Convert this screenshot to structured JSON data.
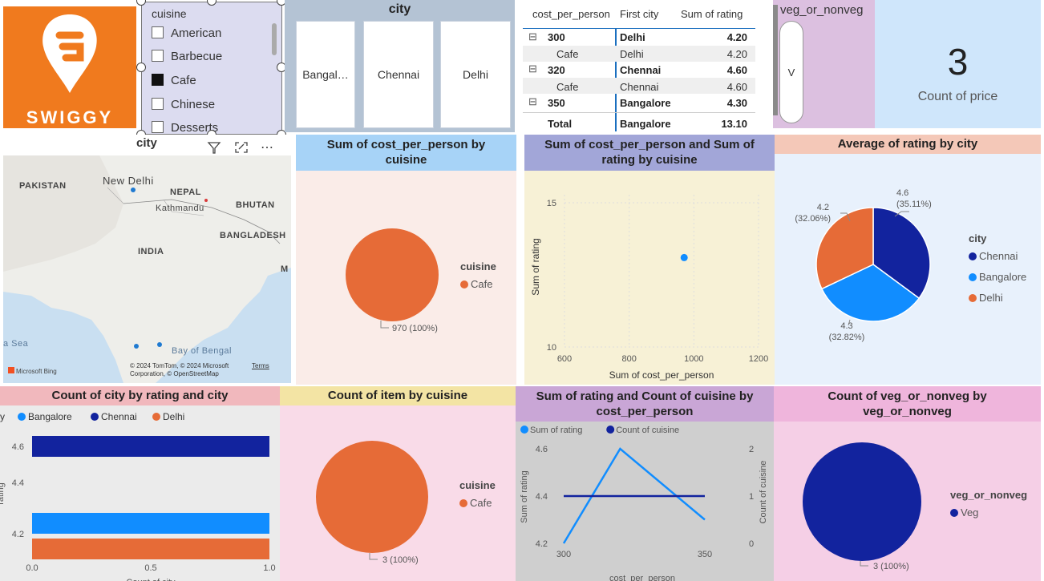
{
  "logo": {
    "text": "SWIGGY",
    "bg": "#f07a1e"
  },
  "cuisine_slicer": {
    "title": "cuisine",
    "items": [
      {
        "label": "American",
        "checked": false
      },
      {
        "label": "Barbecue",
        "checked": false
      },
      {
        "label": "Cafe",
        "checked": true
      },
      {
        "label": "Chinese",
        "checked": false
      },
      {
        "label": "Desserts",
        "checked": false
      }
    ]
  },
  "city_slicer": {
    "title": "city",
    "tiles": [
      "Bangal…",
      "Chennai",
      "Delhi"
    ]
  },
  "matrix": {
    "headers": [
      "cost_per_person",
      "First city",
      "Sum of rating"
    ],
    "rows": [
      {
        "expand": "⊟",
        "cost": "300",
        "city": "Delhi",
        "rating": "4.20",
        "bold": true
      },
      {
        "expand": "",
        "cost": "Cafe",
        "city": "Delhi",
        "rating": "4.20",
        "bold": false
      },
      {
        "expand": "⊟",
        "cost": "320",
        "city": "Chennai",
        "rating": "4.60",
        "bold": true
      },
      {
        "expand": "",
        "cost": "Cafe",
        "city": "Chennai",
        "rating": "4.60",
        "bold": false
      },
      {
        "expand": "⊟",
        "cost": "350",
        "city": "Bangalore",
        "rating": "4.30",
        "bold": true
      }
    ],
    "total": {
      "label": "Total",
      "city": "Bangalore",
      "rating": "13.10"
    }
  },
  "veg_slicer": {
    "title": "veg_or_nonveg",
    "value": "V"
  },
  "card": {
    "value": "3",
    "label": "Count of price"
  },
  "map": {
    "title": "city",
    "labels": [
      "PAKISTAN",
      "New Delhi",
      "NEPAL",
      "Kathmandu",
      "BHUTAN",
      "BANGLADESH",
      "INDIA",
      "Bay of Bengal",
      "a Sea",
      "M"
    ],
    "copyright": "© 2024 TomTom, © 2024 Microsoft Corporation, © OpenStreetMap",
    "terms": "Terms",
    "bing": "Microsoft Bing"
  },
  "colors": {
    "orange": "#e66b37",
    "navy": "#12239e",
    "blue": "#118dff",
    "slicer_bg": "#dcdcf0",
    "card_bg": "#cfe6fb"
  },
  "chart_data": [
    {
      "type": "pie",
      "title": "Sum of cost_per_person by cuisine",
      "legend_title": "cuisine",
      "slices": [
        {
          "label": "Cafe",
          "value": 970,
          "data_label": "970 (100%)",
          "color": "#e66b37"
        }
      ]
    },
    {
      "type": "scatter",
      "title": "Sum of cost_per_person and Sum of rating by cuisine",
      "xlabel": "Sum of cost_per_person",
      "ylabel": "Sum of rating",
      "xlim": [
        600,
        1200
      ],
      "ylim": [
        10,
        15
      ],
      "xticks": [
        "600",
        "800",
        "1000",
        "1200"
      ],
      "yticks": [
        "10",
        "15"
      ],
      "points": [
        {
          "x": 970,
          "y": 13.1
        }
      ]
    },
    {
      "type": "pie",
      "title": "Average of rating by city",
      "legend_title": "city",
      "slices": [
        {
          "label": "Chennai",
          "value": 4.6,
          "data_label": "4.6",
          "pct": "(35.11%)",
          "color": "#12239e"
        },
        {
          "label": "Bangalore",
          "value": 4.3,
          "data_label": "4.3",
          "pct": "(32.82%)",
          "color": "#118dff"
        },
        {
          "label": "Delhi",
          "value": 4.2,
          "data_label": "4.2",
          "pct": "(32.06%)",
          "color": "#e66b37"
        }
      ]
    },
    {
      "type": "bar",
      "title": "Count of city by rating and city",
      "legend_title": "ity",
      "legend": [
        "Bangalore",
        "Chennai",
        "Delhi"
      ],
      "xlabel": "Count of city",
      "ylabel": "rating",
      "xlim": [
        0,
        1
      ],
      "xticks": [
        "0.0",
        "0.5",
        "1.0"
      ],
      "yticks": [
        "4.6",
        "4.4",
        "4.2"
      ],
      "bars": [
        {
          "rating": 4.6,
          "city": "Chennai",
          "value": 1,
          "color": "#12239e"
        },
        {
          "rating": 4.3,
          "city": "Bangalore",
          "value": 1,
          "color": "#118dff"
        },
        {
          "rating": 4.2,
          "city": "Delhi",
          "value": 1,
          "color": "#e66b37"
        }
      ]
    },
    {
      "type": "pie",
      "title": "Count of item by cuisine",
      "legend_title": "cuisine",
      "slices": [
        {
          "label": "Cafe",
          "value": 3,
          "data_label": "3 (100%)",
          "color": "#e66b37"
        }
      ]
    },
    {
      "type": "line",
      "title": "Sum of rating and Count of cuisine by cost_per_person",
      "xlabel": "cost_per_person",
      "ylabel": "Sum of rating",
      "y2label": "Count of cuisine",
      "x": [
        300,
        320,
        350
      ],
      "xticks": [
        "300",
        "350"
      ],
      "yticks": [
        "4.6",
        "4.4",
        "4.2"
      ],
      "y2ticks": [
        "2",
        "1",
        "0"
      ],
      "ylim": [
        4.2,
        4.6
      ],
      "y2lim": [
        0,
        2
      ],
      "series": [
        {
          "name": "Sum of rating",
          "values": [
            4.2,
            4.6,
            4.3
          ],
          "color": "#118dff",
          "axis": "left"
        },
        {
          "name": "Count of cuisine",
          "values": [
            1,
            1,
            1
          ],
          "color": "#12239e",
          "axis": "right"
        }
      ]
    },
    {
      "type": "pie",
      "title": "Count of veg_or_nonveg by veg_or_nonveg",
      "legend_title": "veg_or_nonveg",
      "slices": [
        {
          "label": "Veg",
          "value": 3,
          "data_label": "3 (100%)",
          "color": "#12239e"
        }
      ]
    }
  ]
}
